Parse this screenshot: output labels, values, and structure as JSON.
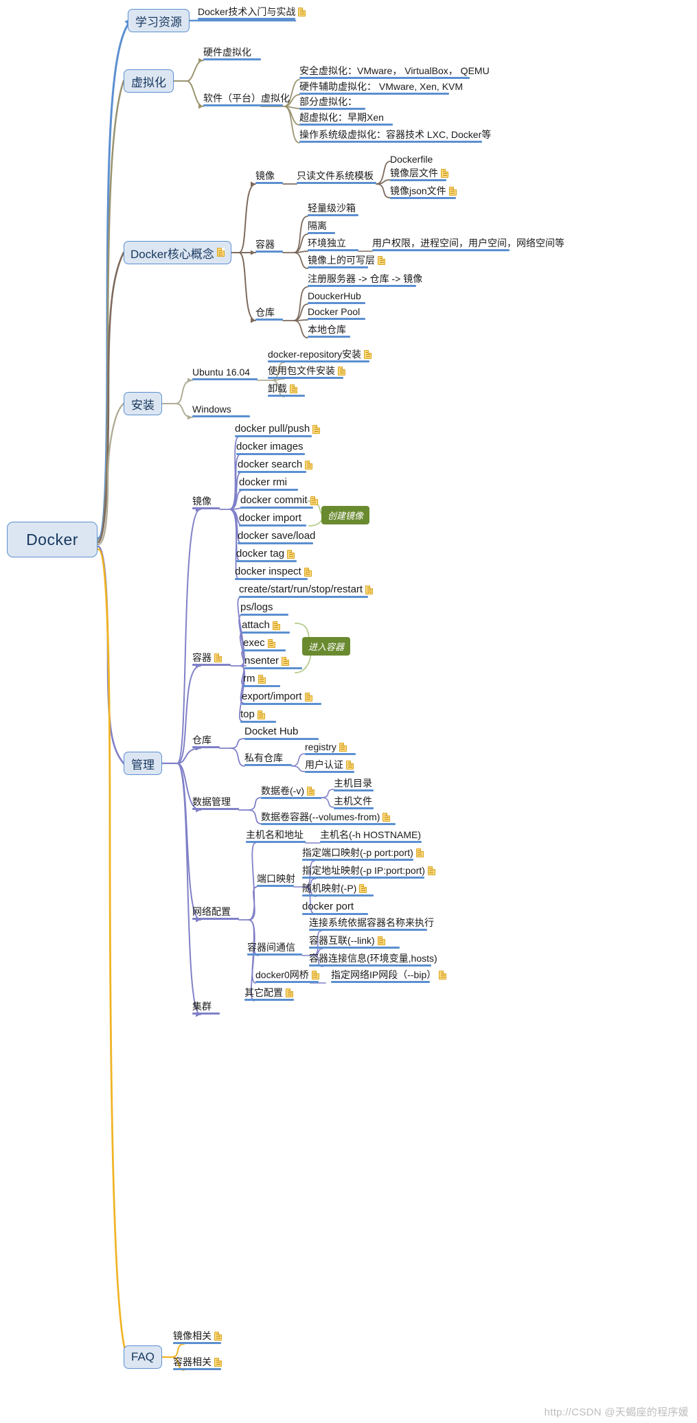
{
  "root": {
    "label": "Docker"
  },
  "watermark": "http://CSDN @天蝎座的程序媛",
  "callouts": [
    {
      "label": "创建镜像"
    },
    {
      "label": "进入容器"
    }
  ],
  "branches": {
    "learning_resources": {
      "label": "学习资源",
      "children": [
        {
          "label": "Docker技术入门与实战",
          "doc": true
        }
      ]
    },
    "virtualization": {
      "label": "虚拟化",
      "children": [
        {
          "label": "硬件虚拟化"
        },
        {
          "label": "软件（平台）虚拟化",
          "children": [
            {
              "label": "安全虚拟化：VMware， VirtualBox， QEMU"
            },
            {
              "label": "硬件辅助虚拟化： VMware, Xen, KVM"
            },
            {
              "label": "部分虚拟化："
            },
            {
              "label": "超虚拟化：早期Xen"
            },
            {
              "label": "操作系统级虚拟化：容器技术 LXC, Docker等"
            }
          ]
        }
      ]
    },
    "core_concepts": {
      "label": "Docker核心概念",
      "doc": true,
      "children": [
        {
          "label": "镜像",
          "children": [
            {
              "label": "只读文件系统模板",
              "children": [
                {
                  "label": "Dockerfile"
                },
                {
                  "label": "镜像层文件",
                  "doc": true
                },
                {
                  "label": "镜像json文件",
                  "doc": true
                }
              ]
            }
          ]
        },
        {
          "label": "容器",
          "children": [
            {
              "label": "轻量级沙箱"
            },
            {
              "label": "隔离"
            },
            {
              "label": "环境独立",
              "detail": "用户权限，进程空间，用户空间，网络空间等"
            },
            {
              "label": "镜像上的可写层",
              "doc": true
            }
          ]
        },
        {
          "label": "仓库",
          "children": [
            {
              "label": "注册服务器 -> 仓库 -> 镜像"
            },
            {
              "label": "DouckerHub"
            },
            {
              "label": "Docker Pool"
            },
            {
              "label": "本地仓库"
            }
          ]
        }
      ]
    },
    "install": {
      "label": "安装",
      "children": [
        {
          "label": "Ubuntu 16.04",
          "children": [
            {
              "label": "docker-repository安装",
              "doc": true
            },
            {
              "label": "使用包文件安装",
              "doc": true
            },
            {
              "label": "卸载",
              "doc": true
            }
          ]
        },
        {
          "label": "Windows"
        }
      ]
    },
    "management": {
      "label": "管理",
      "children": [
        {
          "label": "镜像",
          "children": [
            {
              "label": "docker pull/push",
              "doc": true
            },
            {
              "label": "docker images"
            },
            {
              "label": "docker search",
              "doc": true
            },
            {
              "label": "docker rmi"
            },
            {
              "label": "docker commit",
              "doc": true
            },
            {
              "label": "docker import"
            },
            {
              "label": "docker save/load"
            },
            {
              "label": "docker tag",
              "doc": true
            },
            {
              "label": "docker inspect",
              "doc": true
            }
          ]
        },
        {
          "label": "容器",
          "doc": true,
          "children": [
            {
              "label": "create/start/run/stop/restart",
              "doc": true
            },
            {
              "label": "ps/logs"
            },
            {
              "label": "attach",
              "doc": true
            },
            {
              "label": "exec",
              "doc": true
            },
            {
              "label": "nsenter",
              "doc": true
            },
            {
              "label": "rm",
              "doc": true
            },
            {
              "label": "export/import",
              "doc": true
            },
            {
              "label": "top",
              "doc": true
            }
          ]
        },
        {
          "label": "仓库",
          "children": [
            {
              "label": "Docket Hub"
            },
            {
              "label": "私有仓库",
              "children": [
                {
                  "label": "registry",
                  "doc": true
                },
                {
                  "label": "用户认证",
                  "doc": true
                }
              ]
            }
          ]
        },
        {
          "label": "数据管理",
          "children": [
            {
              "label": "数据卷(-v)",
              "doc": true,
              "children": [
                {
                  "label": "主机目录"
                },
                {
                  "label": "主机文件"
                }
              ]
            },
            {
              "label": "数据卷容器(--volumes-from)",
              "doc": true
            }
          ]
        },
        {
          "label": "网络配置",
          "children": [
            {
              "label": "主机名和地址",
              "detail": "主机名(-h HOSTNAME)"
            },
            {
              "label": "端口映射",
              "children": [
                {
                  "label": "指定端口映射(-p port:port)",
                  "doc": true
                },
                {
                  "label": "指定地址映射(-p IP:port:port)",
                  "doc": true
                },
                {
                  "label": "随机映射(-P)",
                  "doc": true
                },
                {
                  "label": "docker port"
                }
              ]
            },
            {
              "label": "容器间通信",
              "children": [
                {
                  "label": "连接系统依据容器名称来执行"
                },
                {
                  "label": "容器互联(--link)",
                  "doc": true
                },
                {
                  "label": "容器连接信息(环境变量,hosts)"
                }
              ]
            },
            {
              "label": "docker0网桥",
              "doc": true,
              "detail": "指定网络IP网段（--bip）",
              "detail_doc": true
            },
            {
              "label": "其它配置",
              "doc": true
            }
          ]
        },
        {
          "label": "集群"
        }
      ]
    },
    "faq": {
      "label": "FAQ",
      "children": [
        {
          "label": "镜像相关",
          "doc": true
        },
        {
          "label": "容器相关",
          "doc": true
        }
      ]
    }
  },
  "colors": {
    "node_fill": "#dce6f2",
    "node_border": "#5b8fd0",
    "node_text": "#17375e",
    "underline_blue": "#5b8fd0",
    "underline_purple": "#8080c8",
    "link_olive": "#9a9470",
    "link_brown": "#7d6a5d",
    "link_purple": "#8080c8",
    "link_gold": "#f0b323",
    "callout_bg": "#6a8a30"
  }
}
